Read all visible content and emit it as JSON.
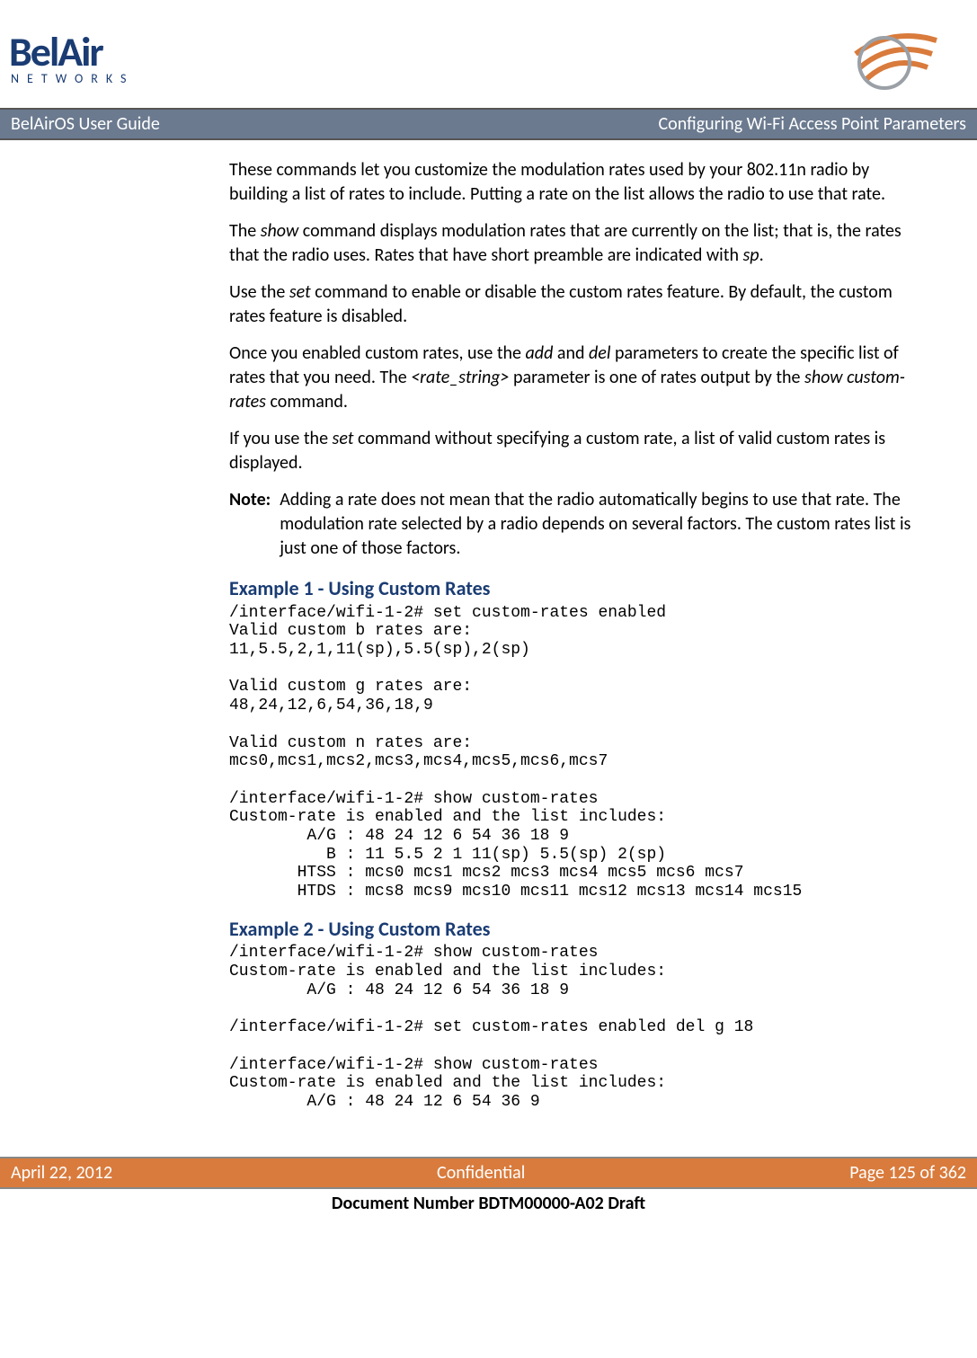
{
  "header": {
    "logo_main": "BelAir",
    "logo_sub": "NETWORKS"
  },
  "titlebar": {
    "left": "BelAirOS User Guide",
    "right": "Configuring Wi-Fi Access Point Parameters"
  },
  "body": {
    "p1": "These commands let you customize the modulation rates used by your 802.11n radio by building a list of rates to include. Putting a rate on the list allows the radio to use that rate.",
    "p2a": "The ",
    "p2b": "show",
    "p2c": " command displays modulation rates that are currently on the list; that is, the rates that the radio uses. Rates that have short preamble are indicated with ",
    "p2d": "sp",
    "p2e": ".",
    "p3a": "Use the ",
    "p3b": "set",
    "p3c": " command to enable or disable the custom rates feature. By default, the custom rates feature is disabled.",
    "p4a": "Once you enabled custom rates, use the ",
    "p4b": "add",
    "p4c": " and ",
    "p4d": "del",
    "p4e": " parameters to create the specific list of rates that you need. The ",
    "p4f": "<rate_string>",
    "p4g": " parameter is one of rates output by the ",
    "p4h": "show custom-rates",
    "p4i": " command.",
    "p5a": "If you use the ",
    "p5b": "set",
    "p5c": " command without specifying a custom rate, a list of valid custom rates is displayed.",
    "note_label": "Note:",
    "note_text": "Adding a rate does not mean that the radio automatically begins to use that rate. The modulation rate selected by a radio depends on several factors. The custom rates list is just one of those factors.",
    "ex1_heading": "Example 1 - Using Custom Rates",
    "ex1_code": "/interface/wifi-1-2# set custom-rates enabled\nValid custom b rates are:\n11,5.5,2,1,11(sp),5.5(sp),2(sp)\n\nValid custom g rates are:\n48,24,12,6,54,36,18,9\n\nValid custom n rates are:\nmcs0,mcs1,mcs2,mcs3,mcs4,mcs5,mcs6,mcs7\n\n/interface/wifi-1-2# show custom-rates\nCustom-rate is enabled and the list includes:\n        A/G : 48 24 12 6 54 36 18 9\n          B : 11 5.5 2 1 11(sp) 5.5(sp) 2(sp)\n       HTSS : mcs0 mcs1 mcs2 mcs3 mcs4 mcs5 mcs6 mcs7\n       HTDS : mcs8 mcs9 mcs10 mcs11 mcs12 mcs13 mcs14 mcs15",
    "ex2_heading": "Example 2 - Using Custom Rates",
    "ex2_code": "/interface/wifi-1-2# show custom-rates\nCustom-rate is enabled and the list includes:\n        A/G : 48 24 12 6 54 36 18 9\n\n/interface/wifi-1-2# set custom-rates enabled del g 18\n\n/interface/wifi-1-2# show custom-rates\nCustom-rate is enabled and the list includes:\n        A/G : 48 24 12 6 54 36 9"
  },
  "footer": {
    "left": "April 22, 2012",
    "center": "Confidential",
    "right": "Page 125 of 362",
    "docnum": "Document Number BDTM00000-A02 Draft"
  }
}
